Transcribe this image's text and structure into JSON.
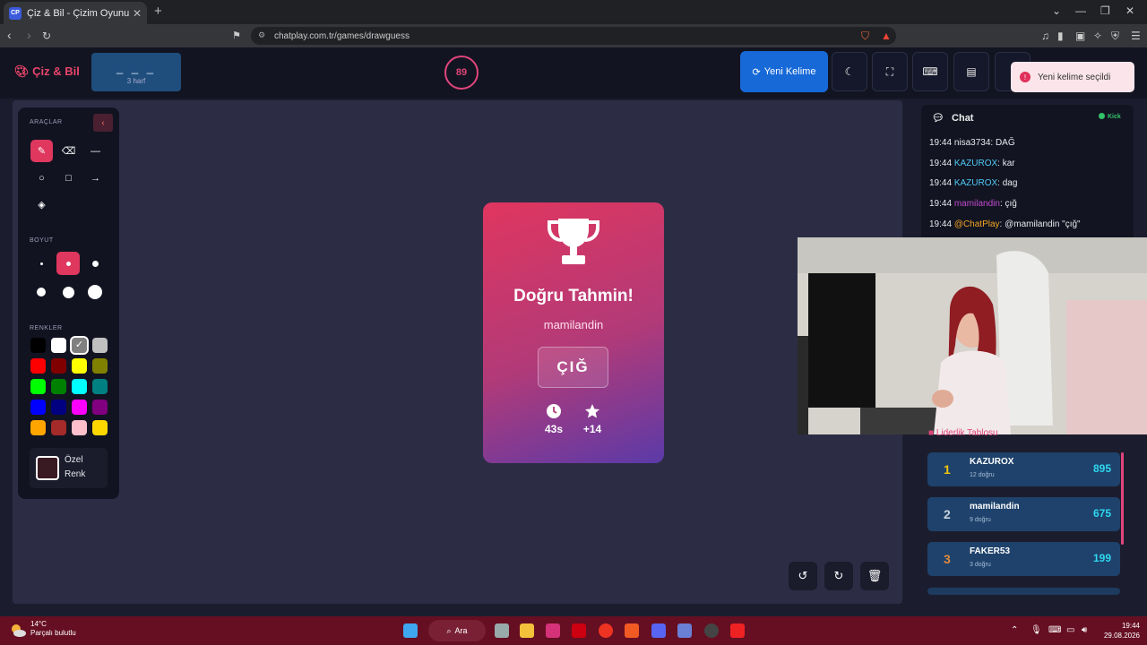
{
  "browser": {
    "tab_title": "Çiz & Bil - Çizim Oyunu",
    "tab_favicon": "CP",
    "url": "chatplay.com.tr/games/drawguess"
  },
  "header": {
    "brand": "Çiz & Bil",
    "word_mask": "_ _ _",
    "word_length": "3 harf",
    "timer": "89",
    "new_word_label": "Yeni Kelime",
    "toast": "Yeni kelime seçildi"
  },
  "tools": {
    "section_tools": "ARAÇLAR",
    "section_size": "BOYUT",
    "section_colors": "RENKLER",
    "custom_color_label": "Özel Renk",
    "colors": [
      "#000000",
      "#ffffff",
      "#808080",
      "#c0c0c0",
      "#ff0000",
      "#800000",
      "#ffff00",
      "#808000",
      "#00ff00",
      "#008000",
      "#00ffff",
      "#008080",
      "#0000ff",
      "#000080",
      "#ff00ff",
      "#800080",
      "#ffa500",
      "#a52a2a",
      "#ffc0cb",
      "#ffd700"
    ],
    "selected_color": "#808080"
  },
  "result": {
    "title": "Doğru Tahmin!",
    "user": "mamilandin",
    "word": "ÇIĞ",
    "time": "43s",
    "points": "+14"
  },
  "chat": {
    "title": "Chat",
    "platform": "Kick",
    "messages": [
      {
        "time": "19:44",
        "user": "nisa3734",
        "text": ": DAĞ",
        "cls": "u0"
      },
      {
        "time": "19:44",
        "user": "KAZUROX",
        "text": ": kar",
        "cls": "u1"
      },
      {
        "time": "19:44",
        "user": "KAZUROX",
        "text": ": dag",
        "cls": "u1"
      },
      {
        "time": "19:44",
        "user": "mamilandin",
        "text": ": çığ",
        "cls": "u2"
      },
      {
        "time": "19:44",
        "user": "@ChatPlay",
        "text": ": @mamilandin \"çığ\"",
        "cls": "u3"
      }
    ]
  },
  "leaderboard": {
    "title": "Liderlik Tablosu",
    "entries": [
      {
        "rank": "1",
        "name": "KAZUROX",
        "sub": "12 doğru",
        "points": "895",
        "color": "#f1c40f"
      },
      {
        "rank": "2",
        "name": "mamilandin",
        "sub": "9 doğru",
        "points": "675",
        "color": "#c9d3de"
      },
      {
        "rank": "3",
        "name": "FAKER53",
        "sub": "3 doğru",
        "points": "199",
        "color": "#e08a3c"
      }
    ]
  },
  "taskbar": {
    "temp": "14°C",
    "weather": "Parçalı bulutlu",
    "search": "Ara",
    "time": "19:44",
    "date": "29.08.2026"
  }
}
